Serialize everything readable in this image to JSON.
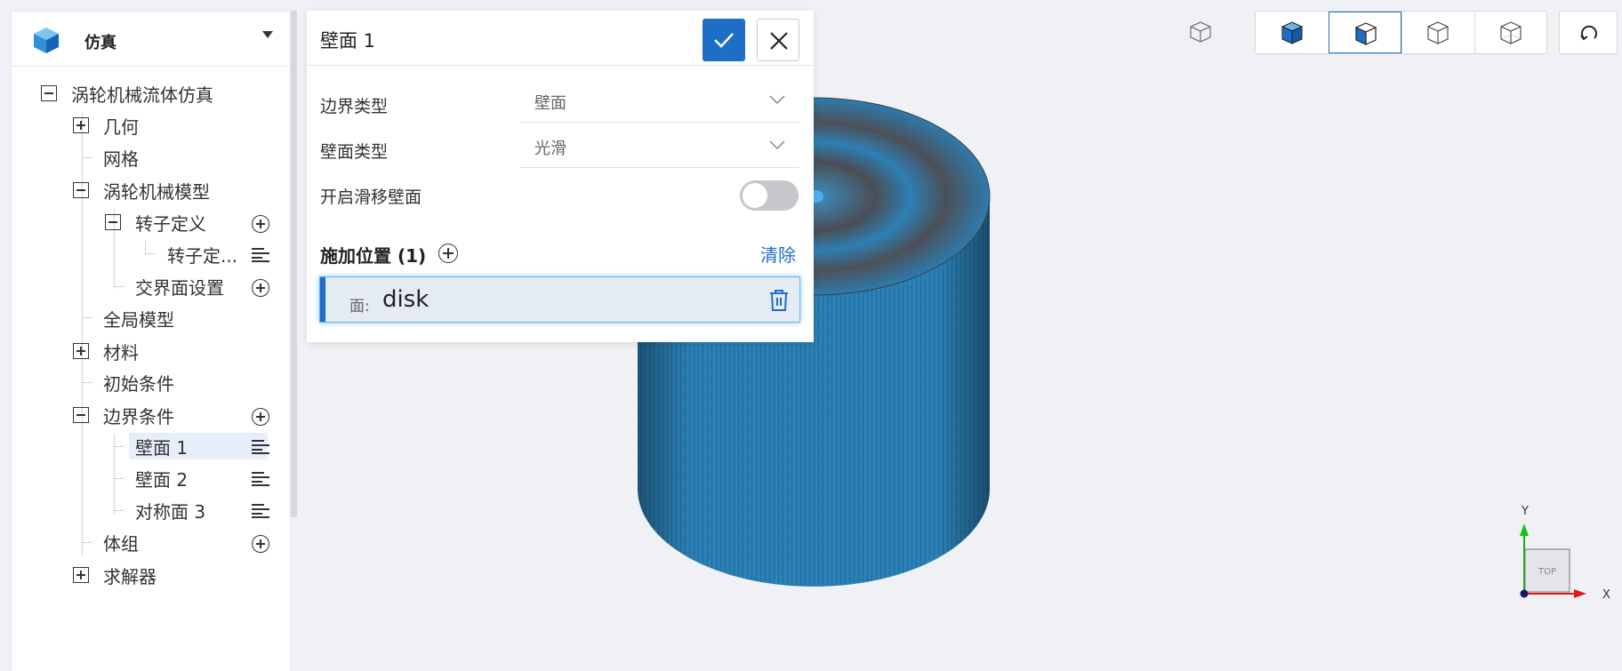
{
  "app": {
    "title": "仿真",
    "logo_icon": "cube-logo-icon"
  },
  "tree": {
    "root": "涡轮机械流体仿真",
    "geometry": "几何",
    "mesh": "网格",
    "turbo_model": "涡轮机械模型",
    "rotor_def": "转子定义",
    "rotor_def_child": "转子定...",
    "interface": "交界面设置",
    "global_model": "全局模型",
    "material": "材料",
    "initial": "初始条件",
    "boundary": "边界条件",
    "wall1": "壁面 1",
    "wall2": "壁面 2",
    "symmetry3": "对称面 3",
    "body_group": "体组",
    "solver": "求解器"
  },
  "dialog": {
    "title": "壁面 1",
    "boundary_type_label": "边界类型",
    "boundary_type_value": "壁面",
    "wall_type_label": "壁面类型",
    "wall_type_value": "光滑",
    "slip_label": "开启滑移壁面",
    "slip_enabled": false,
    "apply_title": "施加位置 (1)",
    "clear_label": "清除",
    "position_prefix": "面:",
    "position_name": "disk"
  },
  "axes": {
    "x": "X",
    "y": "Y",
    "cube": "TOP"
  },
  "colors": {
    "accent": "#1e6ec7",
    "model": "#2b82b8",
    "highlight": "#62b3f0"
  }
}
